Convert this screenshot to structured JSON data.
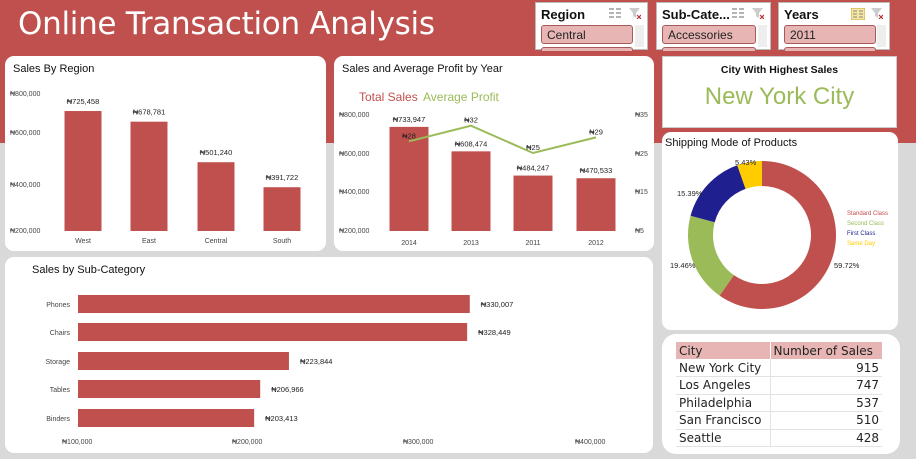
{
  "header": {
    "title": "Online Transaction Analysis"
  },
  "slicers": {
    "region": {
      "title": "Region",
      "selected": "Central"
    },
    "subcategory": {
      "title": "Sub-Cate...",
      "selected": "Accessories"
    },
    "years": {
      "title": "Years",
      "selected": "2011"
    }
  },
  "sales_by_region": {
    "title": "Sales By Region",
    "y_ticks": [
      "₦800,000",
      "₦600,000",
      "₦400,000",
      "₦200,000"
    ]
  },
  "sales_profit_year": {
    "title": "Sales and Average Profit by Year",
    "legend": [
      "Total Sales",
      "Average Profit"
    ],
    "y_ticks_left": [
      "₦800,000",
      "₦600,000",
      "₦400,000",
      "₦200,000"
    ],
    "y_ticks_right": [
      "₦35",
      "₦25",
      "₦15",
      "₦5"
    ]
  },
  "highest_city": {
    "title": "City With Highest Sales",
    "value": "New York City"
  },
  "shipping": {
    "title": "Shipping Mode of Products"
  },
  "subcategory_sales": {
    "title": "Sales by Sub-Category",
    "x_ticks": [
      "₦100,000",
      "₦200,000",
      "₦300,000",
      "₦400,000"
    ]
  },
  "city_table": {
    "headers": [
      "City",
      "Number of Sales"
    ],
    "rows": [
      {
        "city": "New York City",
        "count": "915"
      },
      {
        "city": "Los Angeles",
        "count": "747"
      },
      {
        "city": "Philadelphia",
        "count": "537"
      },
      {
        "city": "San Francisco",
        "count": "510"
      },
      {
        "city": "Seattle",
        "count": "428"
      }
    ]
  },
  "colors": {
    "header": "#c0504d",
    "bar": "#c0504d",
    "line": "#9bbb59",
    "standard": "#c0504d",
    "second": "#9bbb59",
    "first": "#1f1f8f",
    "sameday": "#ffcc00"
  },
  "chart_data": [
    {
      "type": "bar",
      "title": "Sales By Region",
      "categories": [
        "West",
        "East",
        "Central",
        "South"
      ],
      "values": [
        725458,
        678781,
        501240,
        391722
      ],
      "labels": [
        "₦725,458",
        "₦678,781",
        "₦501,240",
        "₦391,722"
      ],
      "ylim": [
        200000,
        800000
      ]
    },
    {
      "type": "bar",
      "title": "Sales and Average Profit by Year",
      "categories": [
        "2014",
        "2013",
        "2011",
        "2012"
      ],
      "series": [
        {
          "name": "Total Sales",
          "values": [
            733947,
            608474,
            484247,
            470533
          ],
          "labels": [
            "₦733,947",
            "₦608,474",
            "₦484,247",
            "₦470,533"
          ]
        },
        {
          "name": "Average Profit",
          "values": [
            28,
            32,
            25,
            29
          ],
          "labels": [
            "₦28",
            "₦32",
            "₦25",
            "₦29"
          ]
        }
      ],
      "ylim": [
        200000,
        800000
      ],
      "ylim_right": [
        5,
        35
      ]
    },
    {
      "type": "pie",
      "title": "Shipping Mode of Products",
      "categories": [
        "Standard Class",
        "Second Class",
        "First Class",
        "Same Day"
      ],
      "values": [
        59.72,
        19.46,
        15.39,
        5.43
      ],
      "labels": [
        "59.72%",
        "19.46%",
        "15.39%",
        "5.43%"
      ]
    },
    {
      "type": "bar",
      "title": "Sales by Sub-Category",
      "categories": [
        "Phones",
        "Chairs",
        "Storage",
        "Tables",
        "Binders"
      ],
      "values": [
        330007,
        328449,
        223844,
        206966,
        203413
      ],
      "labels": [
        "₦330,007",
        "₦328,449",
        "₦223,844",
        "₦206,966",
        "₦203,413"
      ],
      "xlim": [
        100000,
        400000
      ]
    }
  ]
}
